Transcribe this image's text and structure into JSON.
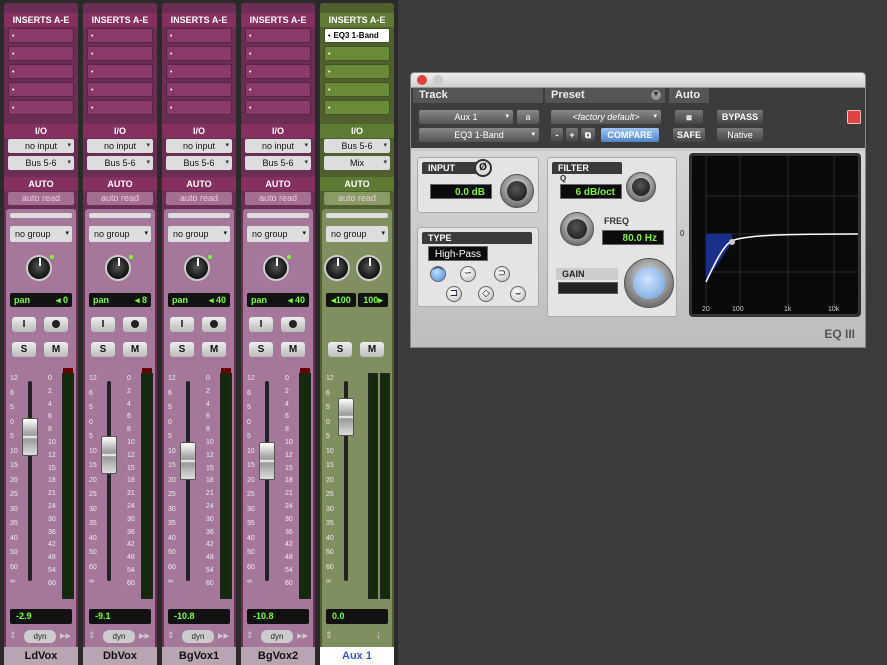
{
  "strips": [
    {
      "color": "purple",
      "inserts_label": "INSERTS A-E",
      "inserts": [
        "",
        "",
        "",
        "",
        ""
      ],
      "io_label": "I/O",
      "input": "no input",
      "output": "Bus 5-6",
      "auto_label": "AUTO",
      "auto_mode": "auto read",
      "group": "no group",
      "pan_label": "pan",
      "pan_value": "0",
      "volume": "-2.9",
      "dyn": "dyn",
      "name": "LdVox",
      "fader_pos": 0.28
    },
    {
      "color": "purple",
      "inserts_label": "INSERTS A-E",
      "inserts": [
        "",
        "",
        "",
        "",
        ""
      ],
      "io_label": "I/O",
      "input": "no input",
      "output": "Bus 5-6",
      "auto_label": "AUTO",
      "auto_mode": "auto read",
      "group": "no group",
      "pan_label": "pan",
      "pan_value": "8",
      "volume": "-9.1",
      "dyn": "dyn",
      "name": "DbVox",
      "fader_pos": 0.37
    },
    {
      "color": "purple",
      "inserts_label": "INSERTS A-E",
      "inserts": [
        "",
        "",
        "",
        "",
        ""
      ],
      "io_label": "I/O",
      "input": "no input",
      "output": "Bus 5-6",
      "auto_label": "AUTO",
      "auto_mode": "auto read",
      "group": "no group",
      "pan_label": "pan",
      "pan_value": "40",
      "volume": "-10.8",
      "dyn": "dyn",
      "name": "BgVox1",
      "fader_pos": 0.4
    },
    {
      "color": "purple",
      "inserts_label": "INSERTS A-E",
      "inserts": [
        "",
        "",
        "",
        "",
        ""
      ],
      "io_label": "I/O",
      "input": "no input",
      "output": "Bus 5-6",
      "auto_label": "AUTO",
      "auto_mode": "auto read",
      "group": "no group",
      "pan_label": "pan",
      "pan_value": "40",
      "volume": "-10.8",
      "dyn": "dyn",
      "name": "BgVox2",
      "fader_pos": 0.4
    },
    {
      "color": "green",
      "inserts_label": "INSERTS A-E",
      "inserts": [
        "EQ3 1-Band",
        "",
        "",
        "",
        ""
      ],
      "io_label": "I/O",
      "input": "Bus 5-6",
      "output": "Mix",
      "auto_label": "AUTO",
      "auto_mode": "auto read",
      "group": "no group",
      "pan_left": "100",
      "pan_right": "100",
      "volume": "0.0",
      "name": "Aux 1",
      "fader_pos": 0.18
    }
  ],
  "fader_scale": [
    "12",
    "6",
    "5",
    "0",
    "5",
    "10",
    "15",
    "20",
    "25",
    "30",
    "35",
    "40",
    "50",
    "60",
    "∞"
  ],
  "meter_scale": [
    "0",
    "2",
    "4",
    "6",
    "8",
    "10",
    "12",
    "15",
    "18",
    "21",
    "24",
    "30",
    "36",
    "42",
    "48",
    "54",
    "60"
  ],
  "buttons": {
    "input": "I",
    "solo": "S",
    "mute": "M"
  },
  "plugin": {
    "track_label": "Track",
    "track_name": "Aux 1",
    "track_chip": "a",
    "insert_name": "EQ3 1-Band",
    "preset_label": "Preset",
    "preset_name": "<factory default>",
    "minus": "-",
    "plus": "+",
    "compare": "COMPARE",
    "auto_label": "Auto",
    "safe": "SAFE",
    "bypass": "BYPASS",
    "native": "Native",
    "input_label": "INPUT",
    "phase_symbol": "Ø",
    "input_value": "0.0 dB",
    "type_label": "TYPE",
    "type_value": "High-Pass",
    "filter_label": "FILTER",
    "q_label": "Q",
    "q_value": "6 dB/oct",
    "freq_label": "FREQ",
    "freq_value": "80.0 Hz",
    "gain_label": "GAIN",
    "graph_ticks": [
      "20",
      "100",
      "1k",
      "10k"
    ],
    "graph_zero": "0",
    "brand": "EQ III"
  },
  "colors": {
    "purple": "#6a2e55",
    "green": "#4f5f2e",
    "lcd": "#7cf03a"
  }
}
